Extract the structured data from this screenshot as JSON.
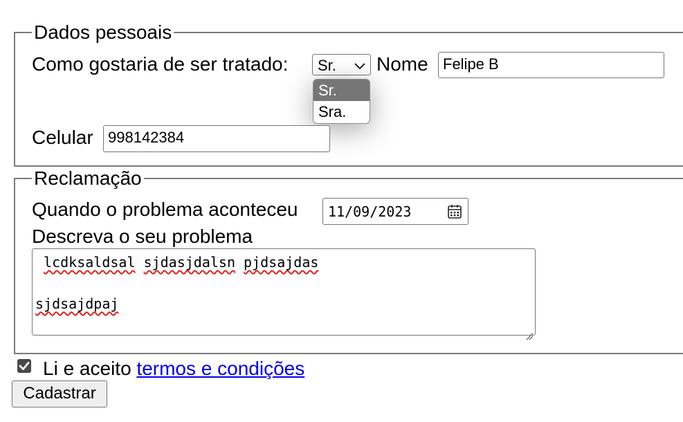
{
  "personal": {
    "legend": "Dados pessoais",
    "treatment_label": "Como gostaria de ser tratado:",
    "treatment_value": "Sr.",
    "treatment_options": [
      "Sr.",
      "Sra."
    ],
    "name_label": "Nome",
    "name_value": "Felipe B",
    "phone_label": "Celular",
    "phone_value": "998142384"
  },
  "complaint": {
    "legend": "Reclamação",
    "date_label": "Quando o problema aconteceu",
    "date_value": "11/09/2023",
    "description_label": "Descreva o seu problema",
    "description_line1": [
      " ",
      "lcdksaldsal",
      " ",
      "sjdasjdalsn",
      " ",
      "pjdsajdas"
    ],
    "description_line2": "",
    "description_line3": "sjdsajdpaj"
  },
  "terms": {
    "checked": true,
    "label": "Li e aceito ",
    "link_label": "termos e condições"
  },
  "submit_label": "Cadastrar",
  "icons": {
    "chevron": "chevron-down-icon",
    "calendar": "calendar-icon",
    "checkbox": "checkbox-checked-icon",
    "resize": "resize-grip-icon"
  },
  "colors": {
    "link": "#0000ee",
    "option_selected_bg": "#767676",
    "checkbox_fill": "#4a4a4a",
    "spell_error": "#e02020"
  }
}
